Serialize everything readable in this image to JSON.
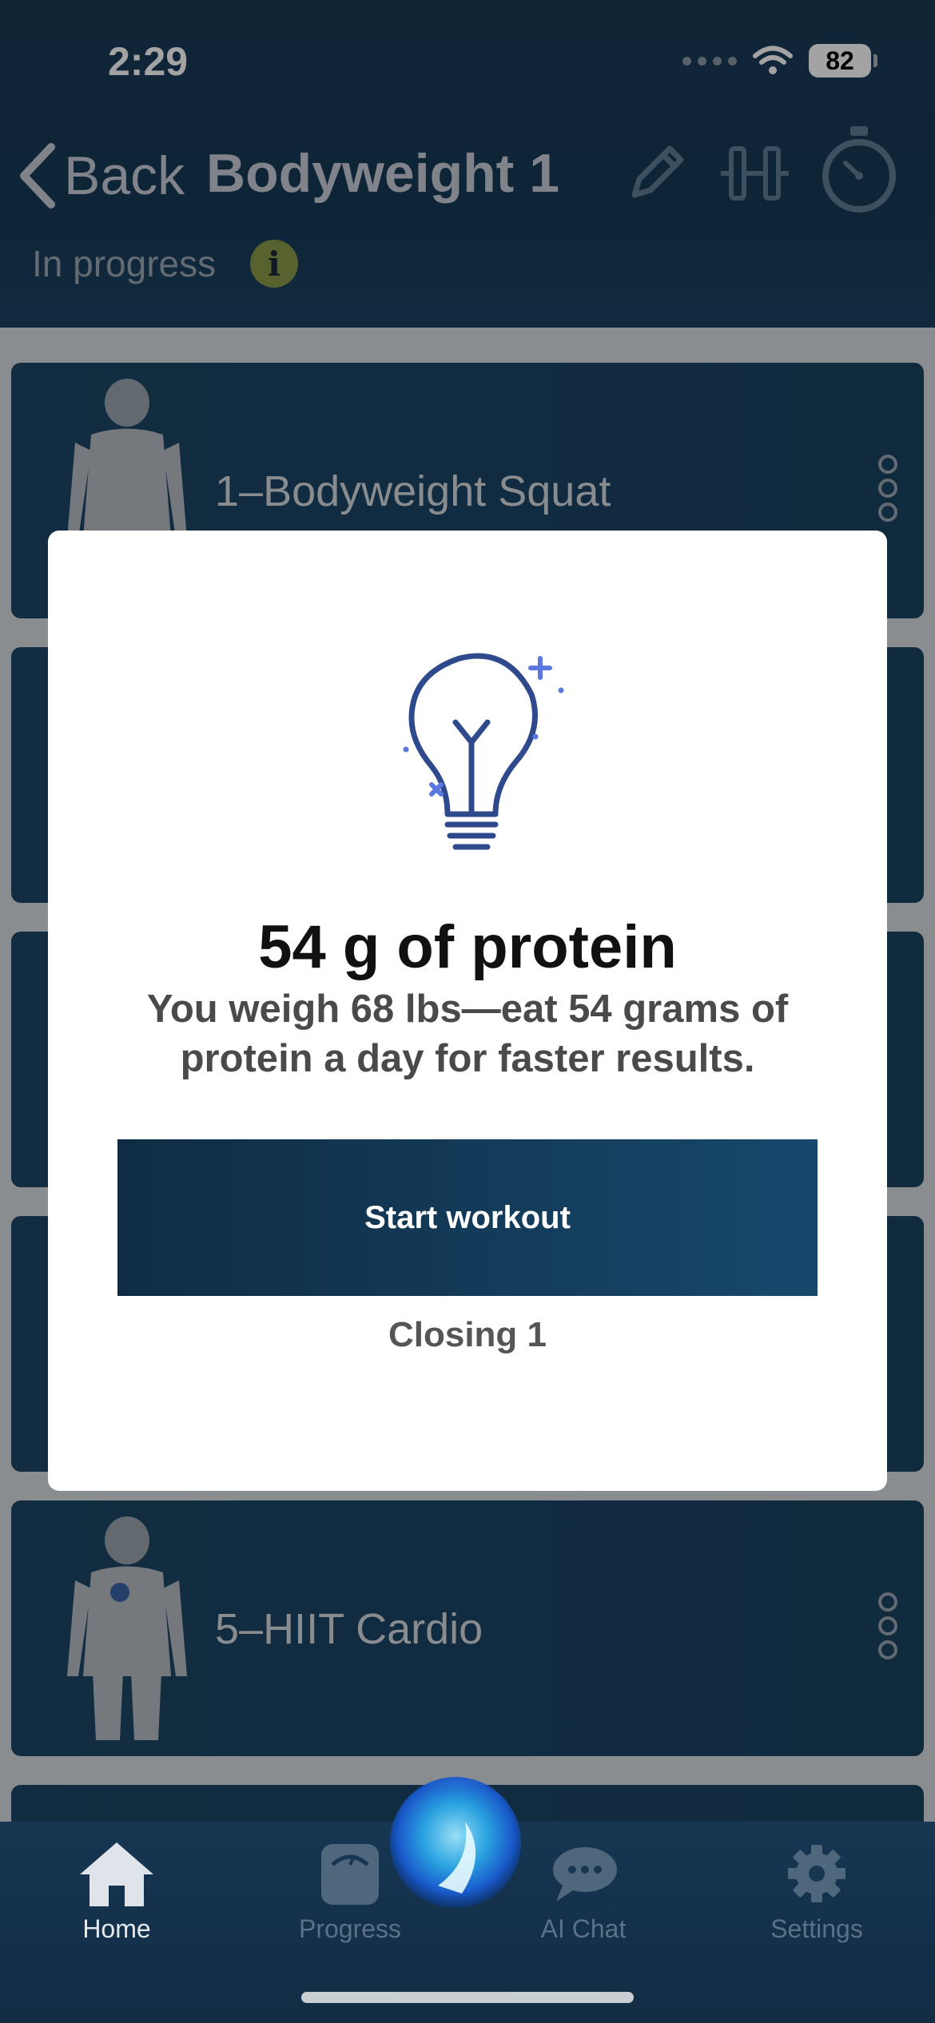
{
  "status_bar": {
    "time": "2:29",
    "battery": "82"
  },
  "header": {
    "back_label": "Back",
    "title": "Bodyweight 1",
    "status": "In progress",
    "info_glyph": "i",
    "icons": [
      "pencil-icon",
      "dumbbell-icon",
      "stopwatch-icon"
    ]
  },
  "exercises": [
    {
      "label": "1–Bodyweight Squat"
    },
    {
      "label": "5–HIIT Cardio"
    }
  ],
  "modal": {
    "title": "54 g of protein",
    "body": "You weigh 68 lbs—eat 54 grams of protein a day for faster results.",
    "button": "Start workout",
    "closing": "Closing 1"
  },
  "tabbar": {
    "items": [
      {
        "label": "Home",
        "icon": "home-icon",
        "active": true
      },
      {
        "label": "Progress",
        "icon": "scale-icon",
        "active": false
      },
      {
        "label": "AI Chat",
        "icon": "chat-icon",
        "active": false
      },
      {
        "label": "Settings",
        "icon": "gear-icon",
        "active": false
      }
    ]
  },
  "colors": {
    "header_bg": "#173a58",
    "card_bg": "#1b4464",
    "button_gradient_start": "#0f2c44",
    "button_gradient_end": "#17486c",
    "bulb_stroke": "#2f4a8c",
    "sparkle": "#5a78e0",
    "info_badge": "#8a9a4a"
  }
}
